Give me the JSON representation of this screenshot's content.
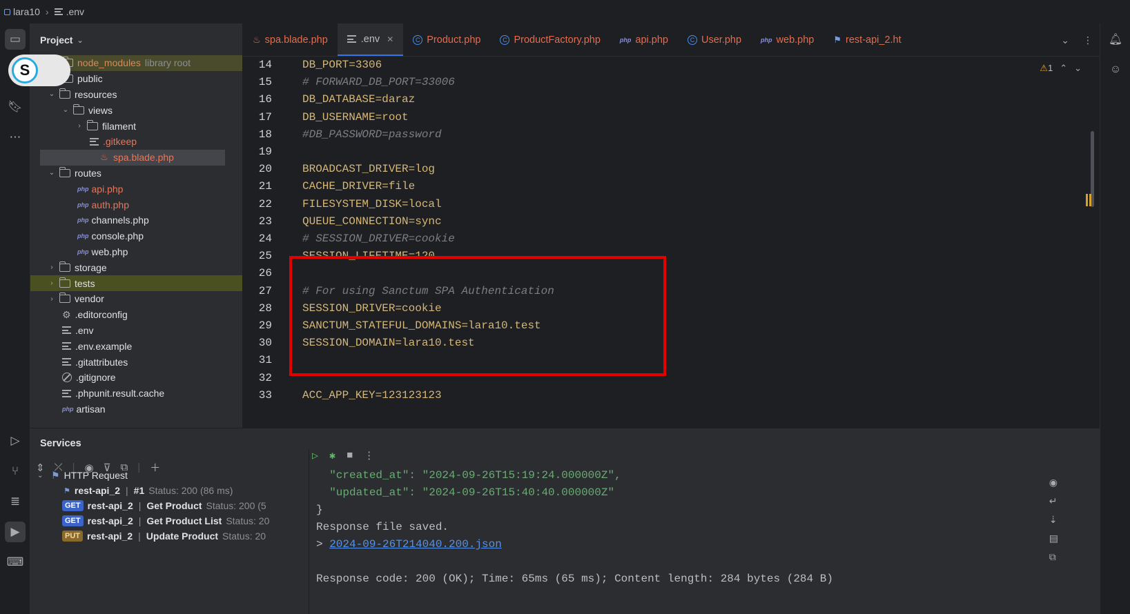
{
  "topbar": {
    "project": "lara10",
    "file": ".env"
  },
  "project_panel": {
    "title": "Project",
    "tree": [
      {
        "label": "node_modules",
        "extra": "library root",
        "kind": "folder",
        "depth": 1,
        "state": "highlight"
      },
      {
        "label": "public",
        "kind": "folder",
        "depth": 1
      },
      {
        "label": "resources",
        "kind": "folder",
        "depth": 1,
        "expanded": true
      },
      {
        "label": "views",
        "kind": "folder",
        "depth": 2,
        "expanded": true
      },
      {
        "label": "filament",
        "kind": "folder",
        "depth": 3,
        "collapsed": true
      },
      {
        "label": ".gitkeep",
        "kind": "text",
        "depth": 4
      },
      {
        "label": "spa.blade.php",
        "kind": "blade",
        "depth": 4,
        "state": "selected"
      },
      {
        "label": "routes",
        "kind": "folder",
        "depth": 1,
        "expanded": true
      },
      {
        "label": "api.php",
        "kind": "php",
        "depth": 2
      },
      {
        "label": "auth.php",
        "kind": "php",
        "depth": 2
      },
      {
        "label": "channels.php",
        "kind": "php",
        "depth": 2
      },
      {
        "label": "console.php",
        "kind": "php",
        "depth": 2
      },
      {
        "label": "web.php",
        "kind": "php",
        "depth": 2
      },
      {
        "label": "storage",
        "kind": "folder",
        "depth": 1,
        "collapsed": true
      },
      {
        "label": "tests",
        "kind": "folder",
        "depth": 1,
        "collapsed": true,
        "state": "olive"
      },
      {
        "label": "vendor",
        "kind": "folder",
        "depth": 1,
        "collapsed": true
      },
      {
        "label": ".editorconfig",
        "kind": "gear",
        "depth": 1
      },
      {
        "label": ".env",
        "kind": "text",
        "depth": 1
      },
      {
        "label": ".env.example",
        "kind": "text",
        "depth": 1
      },
      {
        "label": ".gitattributes",
        "kind": "text",
        "depth": 1
      },
      {
        "label": ".gitignore",
        "kind": "ban",
        "depth": 1
      },
      {
        "label": ".phpunit.result.cache",
        "kind": "text",
        "depth": 1
      },
      {
        "label": "artisan",
        "kind": "php",
        "depth": 1
      }
    ]
  },
  "avatar_letter": "S",
  "tabs": [
    {
      "label": "spa.blade.php",
      "icon": "blade-icon"
    },
    {
      "label": ".env",
      "icon": "text-file-icon",
      "active": true
    },
    {
      "label": "Product.php",
      "icon": "class-icon"
    },
    {
      "label": "ProductFactory.php",
      "icon": "class-icon"
    },
    {
      "label": "api.php",
      "icon": "php-icon"
    },
    {
      "label": "User.php",
      "icon": "class-icon"
    },
    {
      "label": "web.php",
      "icon": "php-icon"
    },
    {
      "label": "rest-api_2.ht",
      "icon": "http-icon"
    }
  ],
  "editor": {
    "warning_count": "1",
    "lines": [
      {
        "n": "14",
        "text": "DB_PORT=3306",
        "comment": false
      },
      {
        "n": "15",
        "text": "# FORWARD_DB_PORT=33006",
        "comment": true
      },
      {
        "n": "16",
        "text": "DB_DATABASE=daraz",
        "comment": false
      },
      {
        "n": "17",
        "text": "DB_USERNAME=root",
        "comment": false
      },
      {
        "n": "18",
        "text": "#DB_PASSWORD=password",
        "comment": true
      },
      {
        "n": "19",
        "text": "",
        "comment": false
      },
      {
        "n": "20",
        "text": "BROADCAST_DRIVER=log",
        "comment": false
      },
      {
        "n": "21",
        "text": "CACHE_DRIVER=file",
        "comment": false
      },
      {
        "n": "22",
        "text": "FILESYSTEM_DISK=local",
        "comment": false
      },
      {
        "n": "23",
        "text": "QUEUE_CONNECTION=sync",
        "comment": false
      },
      {
        "n": "24",
        "text": "# SESSION_DRIVER=cookie",
        "comment": true
      },
      {
        "n": "25",
        "text": "SESSION_LIFETIME=120",
        "comment": false
      },
      {
        "n": "26",
        "text": "",
        "comment": false
      },
      {
        "n": "27",
        "text": "# For using Sanctum SPA Authentication",
        "comment": true
      },
      {
        "n": "28",
        "text": "SESSION_DRIVER=cookie",
        "comment": false
      },
      {
        "n": "29",
        "text": "SANCTUM_STATEFUL_DOMAINS=lara10.test",
        "comment": false
      },
      {
        "n": "30",
        "text": "SESSION_DOMAIN=lara10.test",
        "comment": false
      },
      {
        "n": "31",
        "text": "",
        "comment": false
      },
      {
        "n": "32",
        "text": "",
        "comment": false
      },
      {
        "n": "33",
        "text": "ACC_APP_KEY=123123123",
        "comment": false
      }
    ]
  },
  "services": {
    "title": "Services",
    "tree": [
      {
        "label": "HTTP Request",
        "kind": "group"
      },
      {
        "name": "rest-api_2",
        "suffix": "#1",
        "status": "Status: 200 (86 ms)",
        "kind": "run"
      },
      {
        "method": "GET",
        "name": "rest-api_2",
        "request": "Get Product",
        "status": "Status: 200 (5"
      },
      {
        "method": "GET",
        "name": "rest-api_2",
        "request": "Get Product List",
        "status": "Status: 20"
      },
      {
        "method": "PUT",
        "name": "rest-api_2",
        "request": "Update Product",
        "status": "Status: 20"
      }
    ],
    "console": {
      "created_at": "  \"created_at\": \"2024-09-26T15:19:24.000000Z\",",
      "updated_at": "  \"updated_at\": \"2024-09-26T15:40:40.000000Z\"",
      "brace": "}",
      "saved": "Response file saved.",
      "link_prefix": "> ",
      "link": "2024-09-26T214040.200.json",
      "summary": "Response code: 200 (OK); Time: 65ms (65 ms); Content length: 284 bytes (284 B)"
    }
  }
}
